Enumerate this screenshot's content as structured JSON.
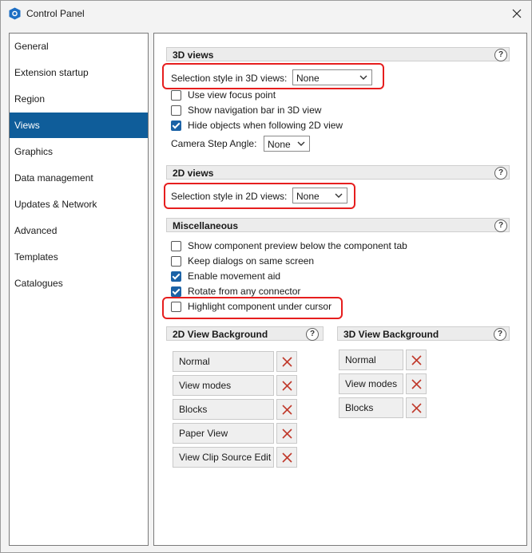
{
  "window": {
    "title": "Control Panel"
  },
  "sidebar": {
    "items": [
      {
        "label": "General"
      },
      {
        "label": "Extension startup"
      },
      {
        "label": "Region"
      },
      {
        "label": "Views"
      },
      {
        "label": "Graphics"
      },
      {
        "label": "Data management"
      },
      {
        "label": "Updates & Network"
      },
      {
        "label": "Advanced"
      },
      {
        "label": "Templates"
      },
      {
        "label": "Catalogues"
      }
    ],
    "active": "Views"
  },
  "views3d": {
    "header": "3D views",
    "help": "?",
    "selection_label": "Selection style in 3D views:",
    "selection_value": "None",
    "options": [
      {
        "label": "Use view focus point",
        "checked": false
      },
      {
        "label": "Show navigation bar in 3D view",
        "checked": false
      },
      {
        "label": "Hide objects when following 2D view",
        "checked": true
      }
    ],
    "camera_label": "Camera Step Angle:",
    "camera_value": "None"
  },
  "views2d": {
    "header": "2D views",
    "help": "?",
    "selection_label": "Selection style in 2D views:",
    "selection_value": "None"
  },
  "misc": {
    "header": "Miscellaneous",
    "help": "?",
    "options": [
      {
        "label": "Show component preview below the component tab",
        "checked": false
      },
      {
        "label": "Keep dialogs on same screen",
        "checked": false
      },
      {
        "label": "Enable movement aid",
        "checked": true
      },
      {
        "label": "Rotate from any connector",
        "checked": true
      },
      {
        "label": "Highlight component under cursor",
        "checked": false
      }
    ]
  },
  "bg2d": {
    "header": "2D View Background",
    "help": "?",
    "items": [
      "Normal",
      "View modes",
      "Blocks",
      "Paper View",
      "View Clip Source Edit"
    ]
  },
  "bg3d": {
    "header": "3D View Background",
    "help": "?",
    "items": [
      "Normal",
      "View modes",
      "Blocks"
    ]
  },
  "colors": {
    "accent": "#0f5d9a",
    "checkbox": "#1b62a6",
    "highlight": "#e61e1e",
    "delete": "#c0392b"
  }
}
